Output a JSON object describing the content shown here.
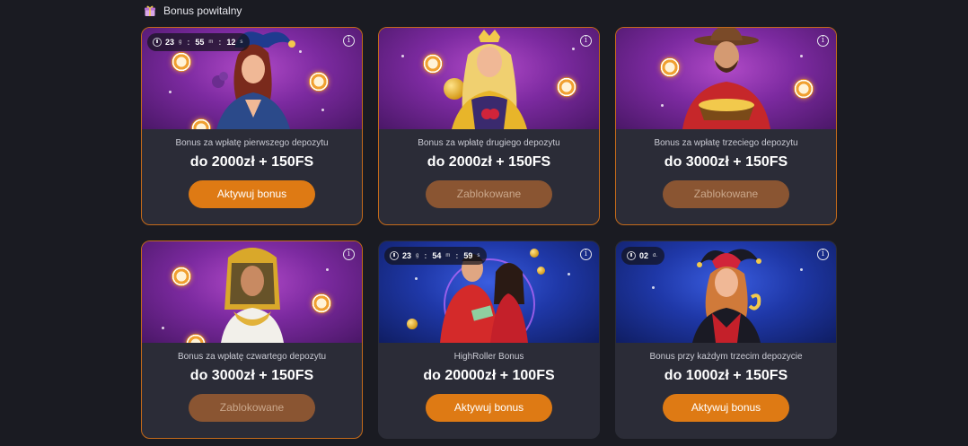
{
  "section": {
    "title": "Bonus powitalny",
    "icon": "gift-icon"
  },
  "colors": {
    "accent": "#de7a14",
    "locked": "#8a5532",
    "card_bg": "#2b2c37",
    "page_bg": "#1a1b22"
  },
  "cards": [
    {
      "subtitle": "Bonus za wpłatę pierwszego depozytu",
      "amount": "do 2000zł + 150FS",
      "button": "Aktywuj bonus",
      "state": "active",
      "theme": "purple",
      "timer": {
        "d": "",
        "h": "23",
        "h_unit": "g",
        "m": "55",
        "m_unit": "m",
        "s": "12",
        "s_unit": "s"
      }
    },
    {
      "subtitle": "Bonus za wpłatę drugiego depozytu",
      "amount": "do 2000zł + 150FS",
      "button": "Zablokowane",
      "state": "locked",
      "theme": "purple"
    },
    {
      "subtitle": "Bonus za wpłatę trzeciego depozytu",
      "amount": "do 3000zł + 150FS",
      "button": "Zablokowane",
      "state": "locked",
      "theme": "purple"
    },
    {
      "subtitle": "Bonus za wpłatę czwartego depozytu",
      "amount": "do 3000zł + 150FS",
      "button": "Zablokowane",
      "state": "locked",
      "theme": "purple"
    },
    {
      "subtitle": "HighRoller Bonus",
      "amount": "do 20000zł + 100FS",
      "button": "Aktywuj bonus",
      "state": "active",
      "theme": "blue",
      "timer": {
        "h": "23",
        "h_unit": "g",
        "m": "54",
        "m_unit": "m",
        "s": "59",
        "s_unit": "s"
      }
    },
    {
      "subtitle": "Bonus przy każdym trzecim depozycie",
      "amount": "do 1000zł + 150FS",
      "button": "Aktywuj bonus",
      "state": "active",
      "theme": "blue",
      "timer": {
        "d": "02",
        "d_unit": "d."
      }
    }
  ],
  "info_glyph": "i"
}
